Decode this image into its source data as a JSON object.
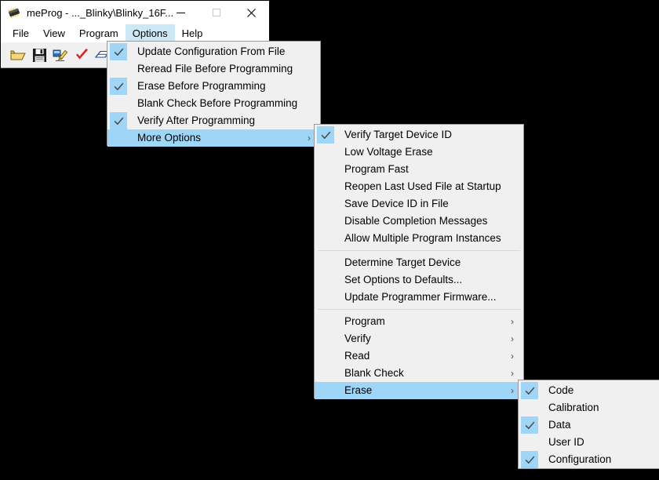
{
  "window": {
    "title": "meProg - ..._Blinky\\Blinky_16F...",
    "icon": "microchip-icon",
    "caption": {
      "minimize": "minimize-icon",
      "maximize": "maximize-icon",
      "close": "close-icon"
    }
  },
  "menubar": {
    "items": [
      {
        "label": "File",
        "active": false
      },
      {
        "label": "View",
        "active": false
      },
      {
        "label": "Program",
        "active": false
      },
      {
        "label": "Options",
        "active": true
      },
      {
        "label": "Help",
        "active": false
      }
    ]
  },
  "toolbar": {
    "buttons": [
      {
        "name": "open-file-icon",
        "title": "Open"
      },
      {
        "name": "save-file-icon",
        "title": "Save"
      },
      {
        "name": "program-device-icon",
        "title": "Program"
      },
      {
        "name": "verify-icon",
        "title": "Verify"
      },
      {
        "name": "read-device-icon",
        "title": "Read"
      },
      {
        "name": "blank-check-icon",
        "title": "Blank Check"
      }
    ]
  },
  "colors": {
    "accent_highlight": "#9fd5f7",
    "menubar_highlight": "#cce8f7",
    "menu_background": "#f0f0f0",
    "menu_border": "#9a9a9a",
    "separator": "#d8d8d8",
    "desktop": "#000000"
  },
  "menus": {
    "options": {
      "name": "options-menu",
      "items": [
        {
          "label": "Update Configuration From File",
          "checked": true,
          "submenu": false,
          "selected": false,
          "separator": false
        },
        {
          "label": "Reread File Before Programming",
          "checked": false,
          "submenu": false,
          "selected": false,
          "separator": false
        },
        {
          "label": "Erase Before Programming",
          "checked": true,
          "submenu": false,
          "selected": false,
          "separator": false
        },
        {
          "label": "Blank Check Before Programming",
          "checked": false,
          "submenu": false,
          "selected": false,
          "separator": false
        },
        {
          "label": "Verify After Programming",
          "checked": true,
          "submenu": false,
          "selected": false,
          "separator": false
        },
        {
          "label": "More Options",
          "checked": false,
          "submenu": true,
          "selected": true,
          "separator": false
        }
      ]
    },
    "more_options": {
      "name": "more-options-menu",
      "items": [
        {
          "label": "Verify Target Device ID",
          "checked": true,
          "submenu": false,
          "selected": false,
          "separator": false
        },
        {
          "label": "Low Voltage Erase",
          "checked": false,
          "submenu": false,
          "selected": false,
          "separator": false
        },
        {
          "label": "Program Fast",
          "checked": false,
          "submenu": false,
          "selected": false,
          "separator": false
        },
        {
          "label": "Reopen Last Used File at Startup",
          "checked": false,
          "submenu": false,
          "selected": false,
          "separator": false
        },
        {
          "label": "Save Device ID in File",
          "checked": false,
          "submenu": false,
          "selected": false,
          "separator": false
        },
        {
          "label": "Disable Completion Messages",
          "checked": false,
          "submenu": false,
          "selected": false,
          "separator": false
        },
        {
          "label": "Allow Multiple Program Instances",
          "checked": false,
          "submenu": false,
          "selected": false,
          "separator": false
        },
        {
          "separator": true
        },
        {
          "label": "Determine Target Device",
          "checked": false,
          "submenu": false,
          "selected": false,
          "separator": false
        },
        {
          "label": "Set Options to Defaults...",
          "checked": false,
          "submenu": false,
          "selected": false,
          "separator": false
        },
        {
          "label": "Update Programmer Firmware...",
          "checked": false,
          "submenu": false,
          "selected": false,
          "separator": false
        },
        {
          "separator": true
        },
        {
          "label": "Program",
          "checked": false,
          "submenu": true,
          "selected": false,
          "separator": false
        },
        {
          "label": "Verify",
          "checked": false,
          "submenu": true,
          "selected": false,
          "separator": false
        },
        {
          "label": "Read",
          "checked": false,
          "submenu": true,
          "selected": false,
          "separator": false
        },
        {
          "label": "Blank Check",
          "checked": false,
          "submenu": true,
          "selected": false,
          "separator": false
        },
        {
          "label": "Erase",
          "checked": false,
          "submenu": true,
          "selected": true,
          "separator": false
        }
      ]
    },
    "erase": {
      "name": "erase-submenu",
      "items": [
        {
          "label": "Code",
          "checked": true,
          "submenu": false,
          "selected": false,
          "separator": false
        },
        {
          "label": "Calibration",
          "checked": false,
          "submenu": false,
          "selected": false,
          "separator": false
        },
        {
          "label": "Data",
          "checked": true,
          "submenu": false,
          "selected": false,
          "separator": false
        },
        {
          "label": "User ID",
          "checked": false,
          "submenu": false,
          "selected": false,
          "separator": false
        },
        {
          "label": "Configuration",
          "checked": true,
          "submenu": false,
          "selected": false,
          "separator": false
        }
      ]
    }
  },
  "glyphs": {
    "check": "✓",
    "submenu_arrow": "›"
  }
}
